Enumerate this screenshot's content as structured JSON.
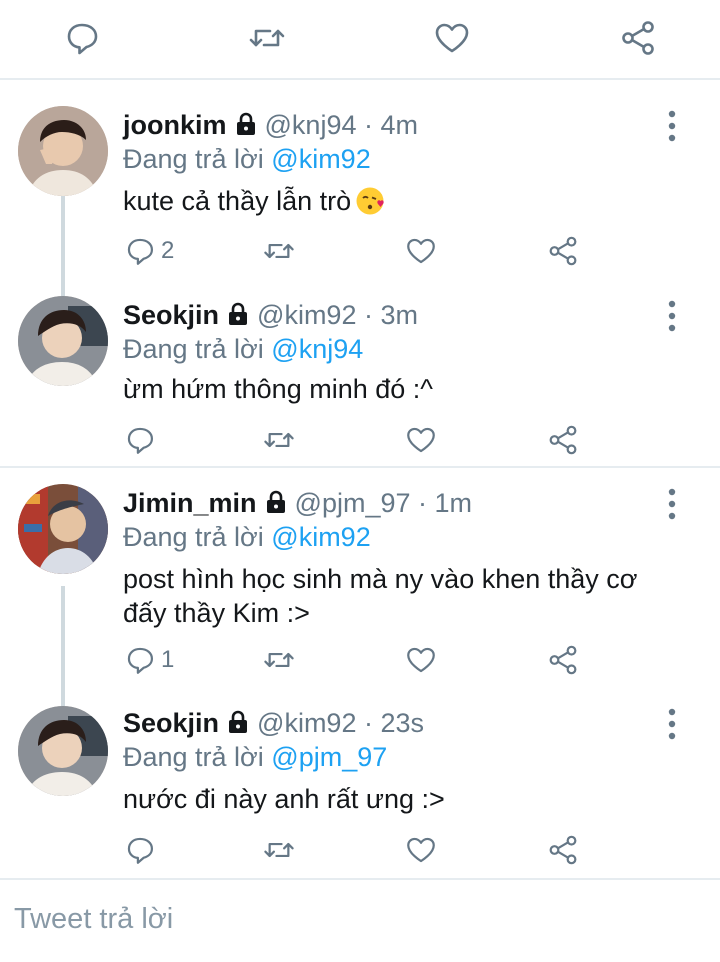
{
  "colors": {
    "accent": "#1da1f2",
    "muted": "#657786",
    "text": "#14171a",
    "divider": "#e6ecf0",
    "thread_line": "#cfd9de"
  },
  "top_actions": [
    "reply-icon",
    "retweet-icon",
    "like-icon",
    "share-icon"
  ],
  "tweets": [
    {
      "display_name": "joonkim",
      "handle_time": "@knj94 · 4m",
      "replying_prefix": "Đang trả lời",
      "replying_to": "@kim92",
      "text": "kute cả thầy lẫn trò",
      "emoji": "kissing-face-emoji",
      "reply_count": "2",
      "locked": true
    },
    {
      "display_name": "Seokjin",
      "handle_time": "@kim92 · 3m",
      "replying_prefix": "Đang trả lời",
      "replying_to": "@knj94",
      "text": "ừm hứm thông minh đó :^",
      "reply_count": "",
      "locked": true
    },
    {
      "display_name": "Jimin_min",
      "handle_time": "@pjm_97 · 1m",
      "replying_prefix": "Đang trả lời",
      "replying_to": "@kim92",
      "text_line1": "post hình học sinh mà ny vào khen thầy cơ",
      "text_line2": "đấy thầy Kim :>",
      "reply_count": "1",
      "locked": true
    },
    {
      "display_name": "Seokjin",
      "handle_time": "@kim92 · 23s",
      "replying_prefix": "Đang trả lời",
      "replying_to": "@pjm_97",
      "text": "nước đi này anh rất ưng :>",
      "reply_count": "",
      "locked": true
    }
  ],
  "reply_box": {
    "placeholder": "Tweet trả lời"
  }
}
